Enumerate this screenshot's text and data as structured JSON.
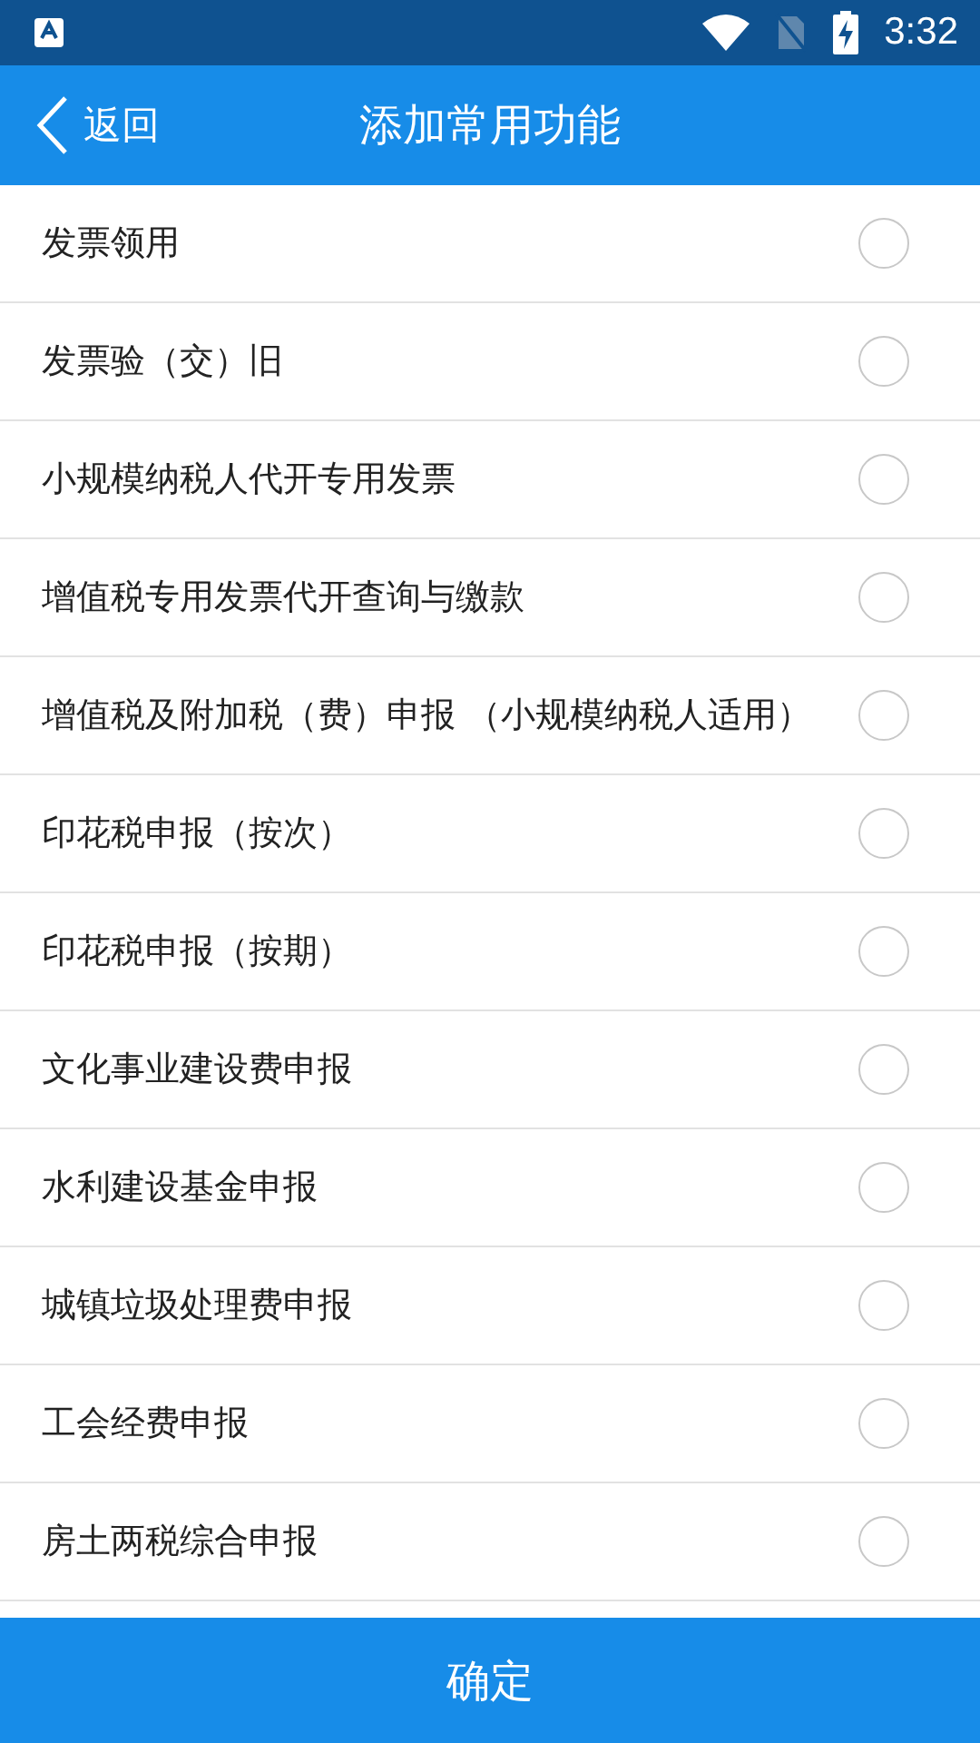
{
  "status_bar": {
    "time": "3:32"
  },
  "header": {
    "back": "返回",
    "title": "添加常用功能"
  },
  "items": [
    {
      "label": "发票领用",
      "selected": false
    },
    {
      "label": "发票验（交）旧",
      "selected": false
    },
    {
      "label": "小规模纳税人代开专用发票",
      "selected": false
    },
    {
      "label": "增值税专用发票代开查询与缴款",
      "selected": false
    },
    {
      "label": "增值税及附加税（费）申报 （小规模纳税人适用）",
      "selected": false
    },
    {
      "label": "印花税申报（按次）",
      "selected": false
    },
    {
      "label": "印花税申报（按期）",
      "selected": false
    },
    {
      "label": "文化事业建设费申报",
      "selected": false
    },
    {
      "label": "水利建设基金申报",
      "selected": false
    },
    {
      "label": "城镇垃圾处理费申报",
      "selected": false
    },
    {
      "label": "工会经费申报",
      "selected": false
    },
    {
      "label": "房土两税综合申报",
      "selected": false
    }
  ],
  "confirm_button": "确定"
}
